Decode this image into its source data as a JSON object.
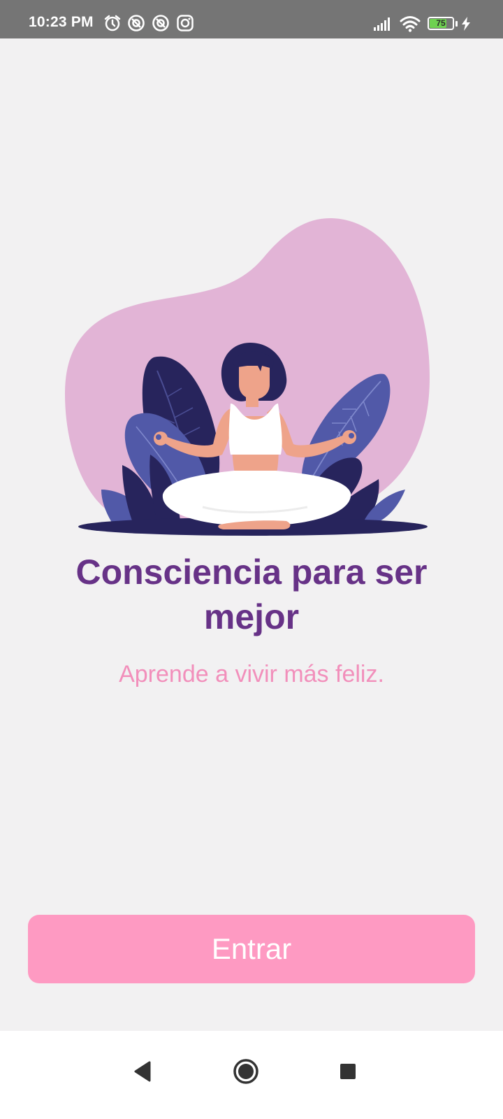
{
  "status_bar": {
    "time": "10:23 PM",
    "battery_level": "75",
    "battery_fraction": 0.75,
    "icons": [
      "alarm-icon",
      "vpn-app-icon",
      "vpn-app-icon",
      "instagram-icon",
      "signal-icon",
      "wifi-icon",
      "battery-icon",
      "charging-icon"
    ]
  },
  "content": {
    "title": "Consciencia para ser mejor",
    "subtitle": "Aprende a vivir más feliz."
  },
  "actions": {
    "enter_label": "Entrar"
  },
  "nav_bar": {
    "icons": [
      "back-icon",
      "home-icon",
      "recents-icon"
    ]
  },
  "colors": {
    "title": "#673287",
    "subtitle": "#f28fbb",
    "button": "#fe9ac2",
    "blob": "#e2b4d6",
    "leaf_dark": "#27245c",
    "leaf_blue": "#5159a8",
    "skin": "#eea38a",
    "status_bar": "#757575",
    "background": "#f2f1f2"
  }
}
